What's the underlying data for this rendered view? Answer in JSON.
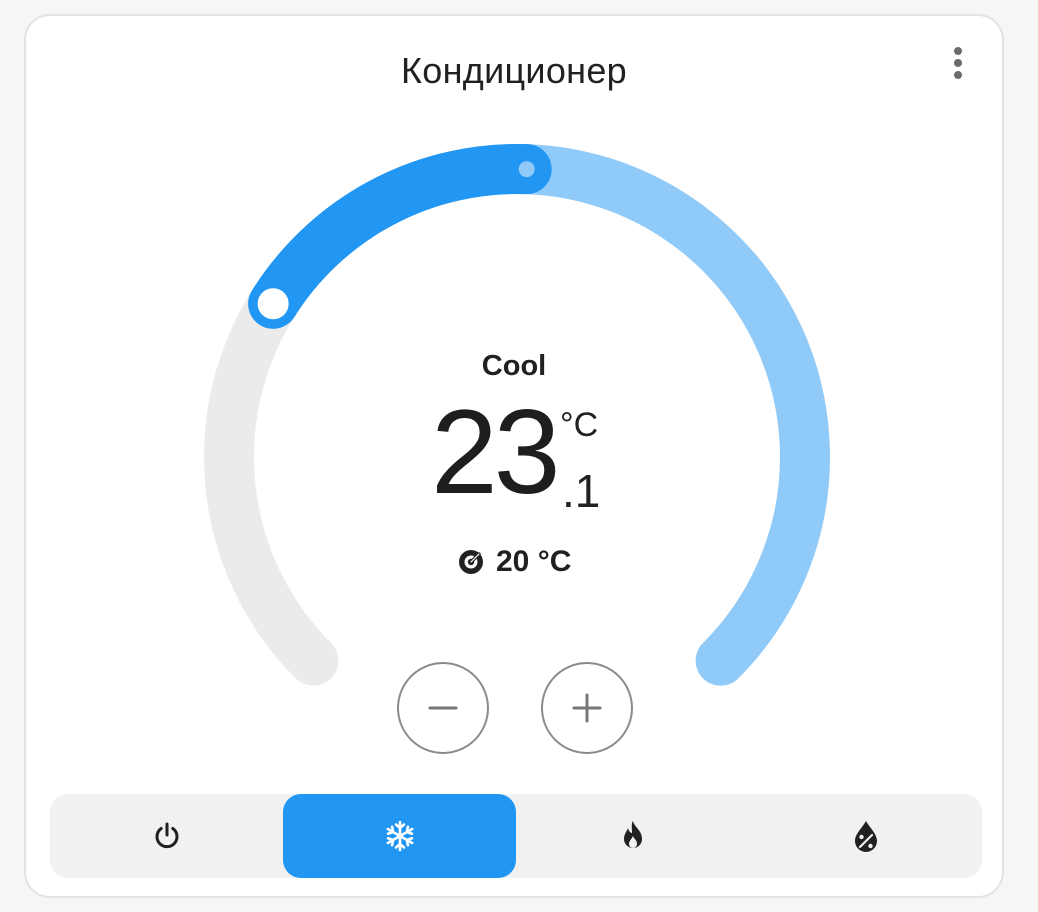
{
  "card": {
    "title": "Кондиционер",
    "menu_icon": "more-vert-icon"
  },
  "gauge": {
    "min_value": 16,
    "max_value": 30,
    "target_value": 20,
    "current_value": 23.1,
    "colors": {
      "track": "#ebebeb",
      "active_range": "#90caf9",
      "fill": "#2196f3",
      "handle_border": "#2196f3",
      "handle_fill": "#ffffff"
    }
  },
  "status": {
    "hvac_action": "Cool",
    "current_temp_integer": "23",
    "current_temp_decimal": ".1",
    "unit": "°C",
    "target_icon": "thermostat-target-icon",
    "target_temp": "20 °C"
  },
  "controls": {
    "decrease_icon": "minus-icon",
    "increase_icon": "plus-icon"
  },
  "modes": [
    {
      "id": "off",
      "icon": "power-icon",
      "active": false
    },
    {
      "id": "cool",
      "icon": "snowflake-icon",
      "active": true
    },
    {
      "id": "heat",
      "icon": "fire-icon",
      "active": false
    },
    {
      "id": "dry",
      "icon": "water-percent-icon",
      "active": false
    }
  ],
  "colors": {
    "accent": "#2196f3",
    "accent_light": "#90caf9",
    "text": "#212121",
    "mode_bar_bg": "#f1f1f1"
  }
}
